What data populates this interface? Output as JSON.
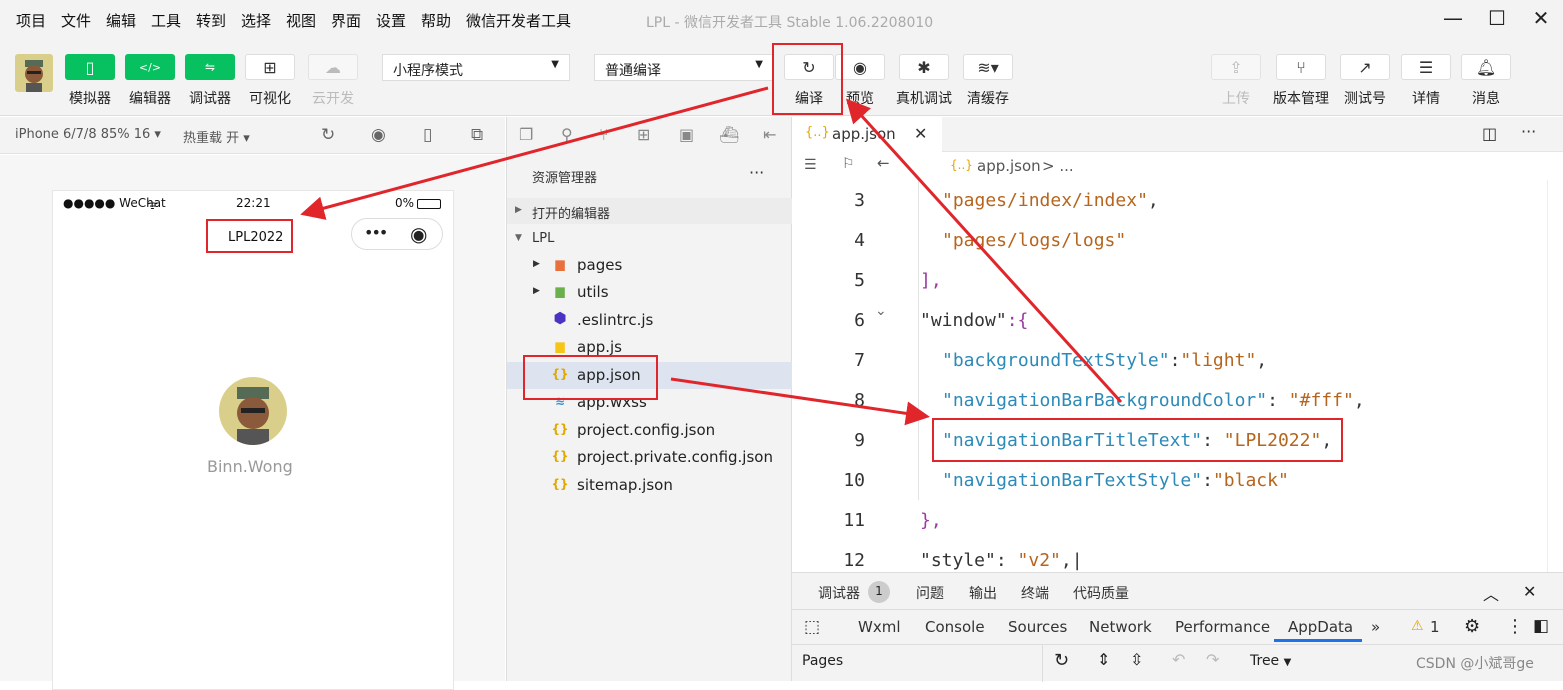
{
  "menu": [
    "项目",
    "文件",
    "编辑",
    "工具",
    "转到",
    "选择",
    "视图",
    "界面",
    "设置",
    "帮助",
    "微信开发者工具"
  ],
  "window_title": "LPL - 微信开发者工具 Stable 1.06.2208010",
  "toolbar": {
    "simulator": "模拟器",
    "editor": "编辑器",
    "debugger": "调试器",
    "visualize": "可视化",
    "cloud": "云开发",
    "mode_select": "小程序模式",
    "compile_select": "普通编译",
    "compile": "编译",
    "preview": "预览",
    "real_debug": "真机调试",
    "clear_cache": "清缓存",
    "upload": "上传",
    "version": "版本管理",
    "test_id": "测试号",
    "details": "详情",
    "messages": "消息"
  },
  "simbar": {
    "device": "iPhone 6/7/8 85% 16 ▾",
    "hot_reload": "热重载 开 ▾"
  },
  "phone": {
    "carrier": "●●●●● WeChat",
    "time": "22:21",
    "battery": "0%",
    "nav_title": "LPL2022",
    "user_name": "Binn.Wong"
  },
  "explorer": {
    "title": "资源管理器",
    "more": "···",
    "open_editors": "打开的编辑器",
    "project": "LPL",
    "files": [
      {
        "name": "pages",
        "icon": "folder-icon"
      },
      {
        "name": "utils",
        "icon": "folder-icon"
      },
      {
        "name": ".eslintrc.js",
        "icon": "eslint-icon"
      },
      {
        "name": "app.js",
        "icon": "js-icon"
      },
      {
        "name": "app.json",
        "icon": "json-icon"
      },
      {
        "name": "app.wxss",
        "icon": "wxss-icon"
      },
      {
        "name": "project.config.json",
        "icon": "json-icon"
      },
      {
        "name": "project.private.config.json",
        "icon": "json-icon"
      },
      {
        "name": "sitemap.json",
        "icon": "json-icon"
      }
    ]
  },
  "editor": {
    "tab": "app.json",
    "breadcrumb": "app.json",
    "breadcrumb_more": "> ...",
    "line_numbers": [
      "3",
      "4",
      "5",
      "6",
      "7",
      "8",
      "9",
      "10",
      "11",
      "12"
    ],
    "code": {
      "l3": "\"pages/index/index\"",
      "l4": "\"pages/logs/logs\"",
      "l5": "],",
      "l6k": "\"window\"",
      "l6p": ":{",
      "l7k": "\"backgroundTextStyle\"",
      "l7v": "\"light\"",
      "l8k": "\"navigationBarBackgroundColor\"",
      "l8v": "\"#fff\"",
      "l9k": "\"navigationBarTitleText\"",
      "l9v": "\"LPL2022\"",
      "l10k": "\"navigationBarTextStyle\"",
      "l10v": "\"black\"",
      "l11": "},",
      "l12k": "\"style\"",
      "l12v": "\"v2\""
    }
  },
  "devtools": {
    "tabs": [
      "调试器",
      "问题",
      "输出",
      "终端",
      "代码质量"
    ],
    "badge": "1",
    "panels": [
      "Wxml",
      "Console",
      "Sources",
      "Network",
      "Performance",
      "AppData"
    ],
    "more": "»",
    "warn": "1",
    "left_panel": "Pages",
    "tree": "Tree"
  },
  "watermark": "CSDN @小斌哥ge"
}
